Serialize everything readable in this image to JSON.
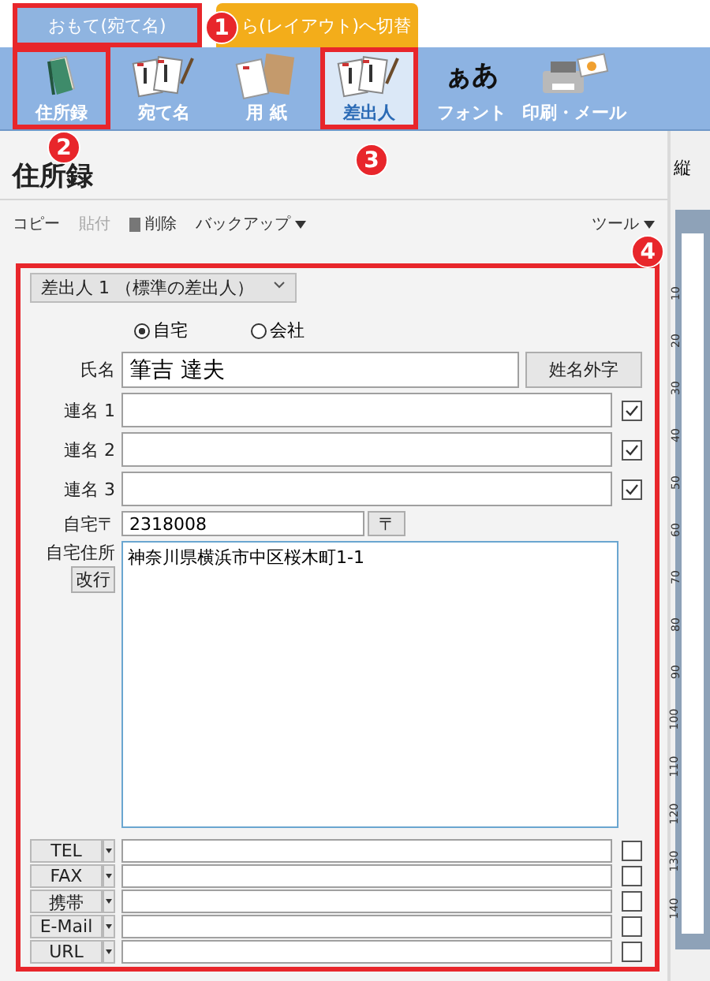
{
  "tabs": [
    {
      "label": "おもて(宛て名)",
      "selected": true,
      "highlighted": true,
      "marker": "1"
    },
    {
      "label": "ら(レイアウト)へ切替",
      "selected": false,
      "highlighted": false
    }
  ],
  "toolbar": [
    {
      "kind": "book",
      "label": "住所録",
      "selected": false,
      "highlighted": true,
      "marker": "2"
    },
    {
      "kind": "cards",
      "label": "宛て名",
      "selected": false,
      "highlighted": false
    },
    {
      "kind": "paper",
      "label": "用 紙",
      "selected": false,
      "highlighted": false
    },
    {
      "kind": "cards-pen",
      "label": "差出人",
      "selected": true,
      "highlighted": true,
      "marker": "3"
    },
    {
      "kind": "text",
      "icon_text": "ぁあ",
      "label": "フォント",
      "selected": false,
      "highlighted": false
    },
    {
      "kind": "printer",
      "label": "印刷・メール",
      "selected": false,
      "highlighted": false
    }
  ],
  "panel": {
    "title": "住所録",
    "actions": [
      {
        "label": "コピー",
        "kind": "plain",
        "disabled": false
      },
      {
        "label": "貼付",
        "kind": "plain",
        "disabled": true
      },
      {
        "label": "削除",
        "kind": "trash",
        "disabled": false
      },
      {
        "label": "バックアップ",
        "kind": "menu",
        "disabled": false
      }
    ],
    "tools": "ツール"
  },
  "form": {
    "marker": "4",
    "sender": "差出人 1 （標準の差出人）",
    "address_type": [
      {
        "label": "自宅",
        "selected": true
      },
      {
        "label": "会社",
        "selected": false
      }
    ],
    "name_label": "氏名",
    "name": "筆吉 達夫",
    "gaiji_button": "姓名外字",
    "joint_names": [
      {
        "label": "連名 1",
        "checked": true
      },
      {
        "label": "連名 2",
        "checked": true
      },
      {
        "label": "連名 3",
        "checked": true
      }
    ],
    "postal_label": "自宅〒",
    "postal": "2318008",
    "postal_button": "〒",
    "address_label": "自宅住所",
    "newline_button": "改行",
    "address": "神奈川県横浜市中区桜木町1-1",
    "contacts": [
      {
        "type": "TEL",
        "checked": false
      },
      {
        "type": "FAX",
        "checked": false
      },
      {
        "type": "携帯",
        "checked": false
      },
      {
        "type": "E-Mail",
        "checked": false
      },
      {
        "type": "URL",
        "checked": false
      }
    ]
  },
  "side": {
    "header": "縦",
    "ruler": [
      "10",
      "20",
      "30",
      "40",
      "50",
      "60",
      "70",
      "80",
      "90",
      "100",
      "110",
      "120",
      "130",
      "140"
    ]
  }
}
